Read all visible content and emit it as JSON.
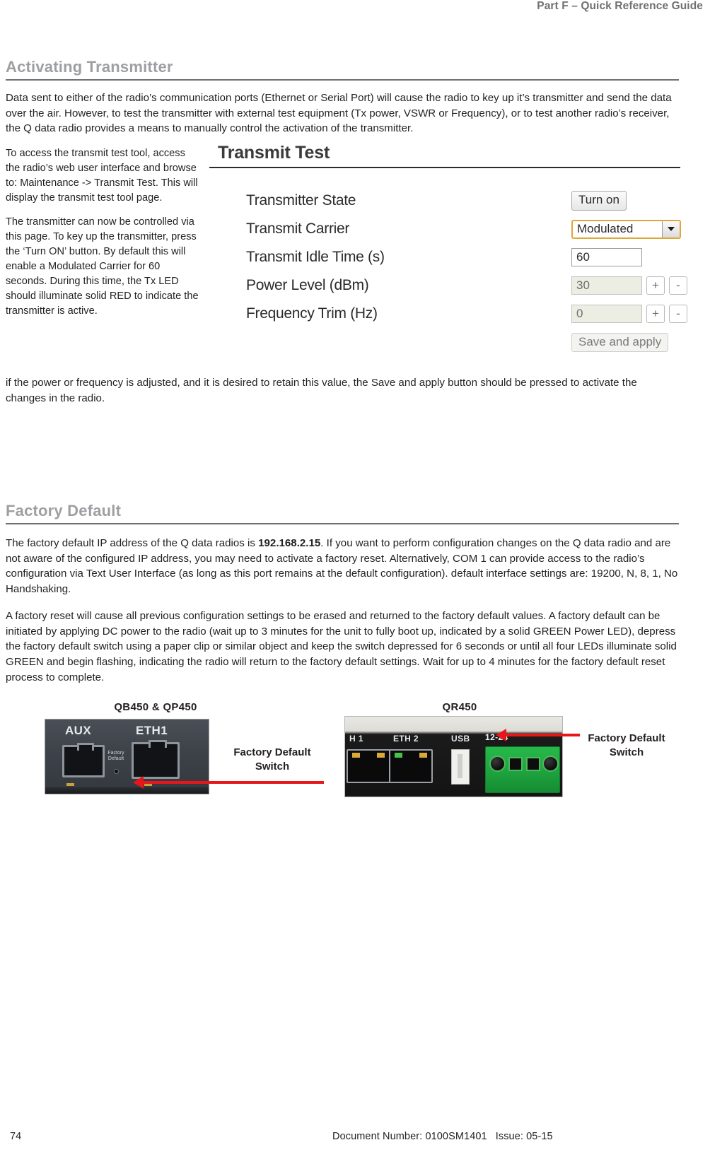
{
  "header": {
    "running_title": "Part F – Quick Reference Guide"
  },
  "sections": {
    "activating": {
      "heading": "Activating Transmitter",
      "intro": "Data sent to either of the radio’s communication ports (Ethernet or Serial Port) will cause the radio to key up it’s transmitter and send the data over the air. However, to test the transmitter with external test equipment (Tx power, VSWR or Frequency), or to test another radio’s receiver, the Q data radio provides a means to manually control the activation of the transmitter.",
      "left_para_1": "To access the transmit test tool, access the radio’s web user interface and browse to: Maintenance -> Transmit Test. This will display the transmit test tool page.",
      "left_para_2": "The transmitter can now be controlled via this page. To key up the transmitter, press the ‘Turn ON’ button. By default this will enable a Modulated Carrier for 60 seconds. During this time, the Tx LED should illuminate solid RED to indicate the transmitter is active.",
      "after_panel_para": "if the power or frequency is adjusted, and it is desired to retain this value, the Save and apply button should be pressed to activate the changes in the radio."
    },
    "factory_default": {
      "heading": "Factory Default",
      "para_1_before_ip": "The factory default IP address of the Q data radios is ",
      "para_1_ip": "192.168.2.15",
      "para_1_after_ip": ". If you want to perform configuration changes on the Q data radio and are not aware of the configured IP address, you may need to activate a factory reset. Alternatively, COM 1 can provide access to the radio’s configuration via Text User Interface (as long as this port remains at the default configuration). default interface settings are: 19200, N, 8, 1, No Handshaking.",
      "para_2": "A factory reset will cause all previous configuration settings to be erased and returned to the factory default values. A factory default can be initiated by applying DC power to the radio (wait up to 3 minutes for the unit to fully boot up, indicated by a solid GREEN Power LED), depress the factory default switch using a paper clip or similar object and keep the switch depressed for 6 seconds or until all four LEDs illuminate solid GREEN and begin flashing, indicating the radio will return to the factory default settings. Wait for up to 4 minutes for the factory default reset process to complete."
    }
  },
  "transmit_test_panel": {
    "title": "Transmit Test",
    "rows": [
      {
        "label": "Transmitter State",
        "control": "button",
        "value": "Turn on"
      },
      {
        "label": "Transmit Carrier",
        "control": "select",
        "value": "Modulated"
      },
      {
        "label": "Transmit Idle Time (s)",
        "control": "text",
        "value": "60"
      },
      {
        "label": "Power Level (dBm)",
        "control": "stepper",
        "value": "30"
      },
      {
        "label": "Frequency Trim (Hz)",
        "control": "stepper",
        "value": "0"
      }
    ],
    "plus_label": "+",
    "minus_label": "-",
    "save_label": "Save and apply"
  },
  "figures": {
    "left": {
      "caption": "QB450 & QP450",
      "callout": "Factory Default Switch",
      "photo_labels": {
        "aux": "AUX",
        "eth1": "ETH1",
        "factory_default": "Factory Default"
      }
    },
    "right": {
      "caption": "QR450",
      "callout": "Factory Default Switch",
      "photo_labels": {
        "eth1": "H 1",
        "eth2": "ETH 2",
        "usb": "USB",
        "power": "12-24"
      }
    },
    "arrow_color": "#e8161a"
  },
  "footer": {
    "page_number": "74",
    "document_number": "Document Number: 0100SM1401",
    "issue": "Issue: 05-15"
  }
}
